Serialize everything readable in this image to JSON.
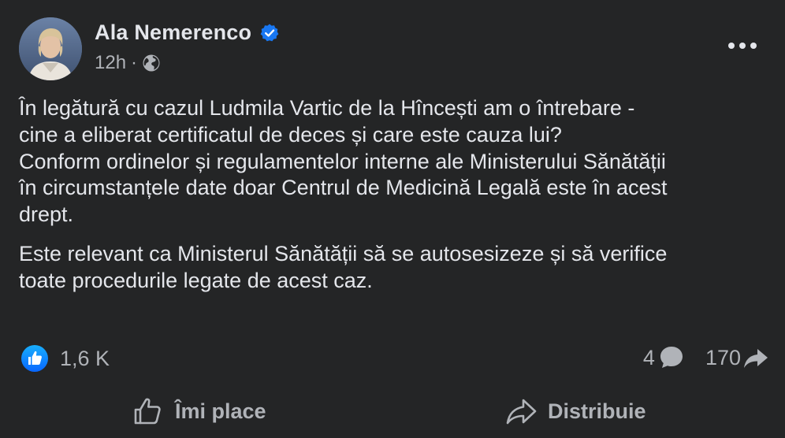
{
  "post": {
    "author": "Ala Nemerenco",
    "time": "12h",
    "separator": "·",
    "paragraphs": [
      "În legătură cu cazul Ludmila Vartic de la Hîncești am o întrebare -\ncine a eliberat certificatul de deces și care este cauza lui?\nConform ordinelor și regulamentelor interne ale Ministerului Sănătății\nîn circumstanțele date doar Centrul de Medicină Legală este în acest\ndrept.",
      "Este relevant ca Ministerul Sănătății să se autosesizeze și să verifice\ntoate procedurile legate de acest caz."
    ]
  },
  "stats": {
    "reactions": "1,6 K",
    "comments": "4",
    "shares": "170"
  },
  "actions": {
    "like_label": "Îmi place",
    "share_label": "Distribuie"
  },
  "colors": {
    "background": "#242526",
    "accent": "#1877f2",
    "text_primary": "#e4e6eb",
    "text_secondary": "#b0b3b8"
  },
  "icons": [
    "verified-badge-icon",
    "globe-icon",
    "more-options-icon",
    "like-reaction-icon",
    "comment-icon",
    "share-icon",
    "thumbs-up-icon"
  ]
}
